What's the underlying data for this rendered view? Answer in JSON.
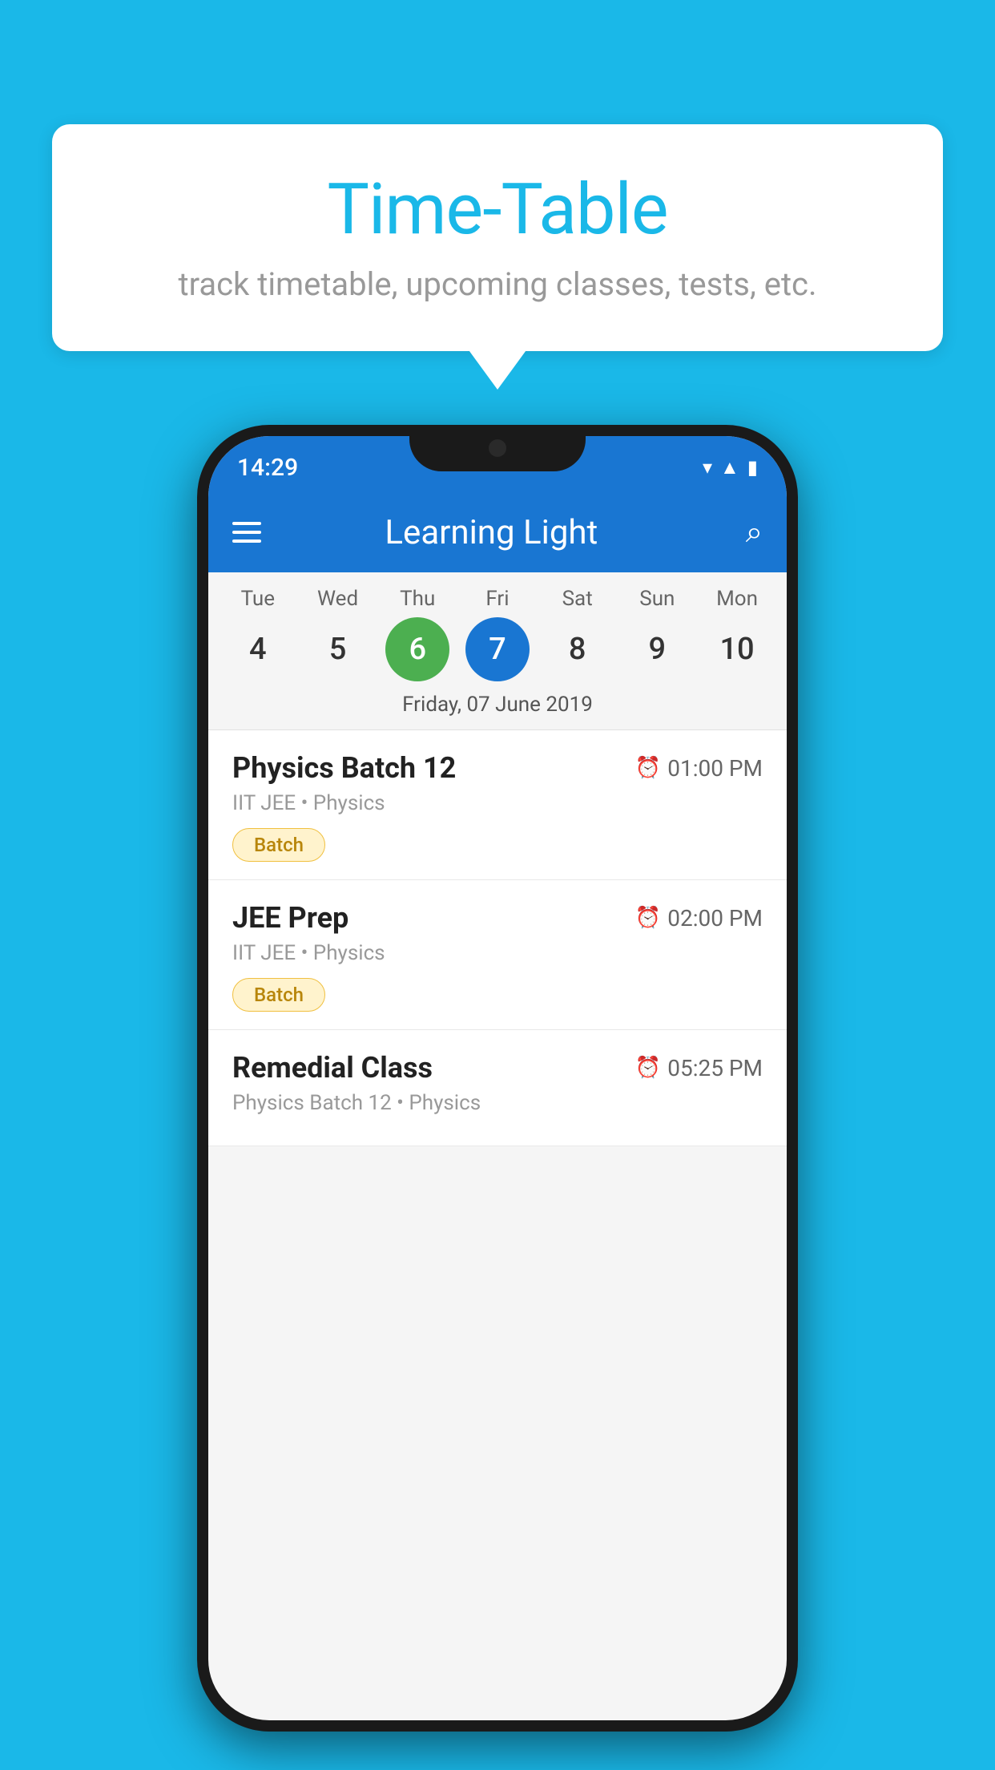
{
  "background_color": "#1ab8e8",
  "speech_bubble": {
    "title": "Time-Table",
    "subtitle": "track timetable, upcoming classes, tests, etc."
  },
  "phone": {
    "status_bar": {
      "time": "14:29"
    },
    "app_bar": {
      "title": "Learning Light"
    },
    "calendar": {
      "days": [
        {
          "label": "Tue",
          "number": "4"
        },
        {
          "label": "Wed",
          "number": "5"
        },
        {
          "label": "Thu",
          "number": "6",
          "state": "today"
        },
        {
          "label": "Fri",
          "number": "7",
          "state": "selected"
        },
        {
          "label": "Sat",
          "number": "8"
        },
        {
          "label": "Sun",
          "number": "9"
        },
        {
          "label": "Mon",
          "number": "10"
        }
      ],
      "selected_date": "Friday, 07 June 2019"
    },
    "classes": [
      {
        "name": "Physics Batch 12",
        "time": "01:00 PM",
        "meta": "IIT JEE • Physics",
        "badge": "Batch"
      },
      {
        "name": "JEE Prep",
        "time": "02:00 PM",
        "meta": "IIT JEE • Physics",
        "badge": "Batch"
      },
      {
        "name": "Remedial Class",
        "time": "05:25 PM",
        "meta": "Physics Batch 12 • Physics",
        "badge": ""
      }
    ]
  }
}
